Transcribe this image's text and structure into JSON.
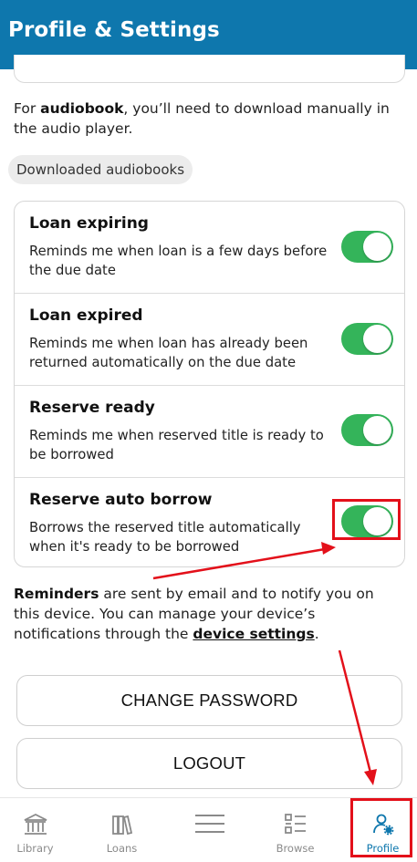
{
  "header": {
    "title": "Profile & Settings"
  },
  "intro": {
    "prefix": "For ",
    "bold": "audiobook",
    "suffix": ", you’ll need to download manually in the audio player."
  },
  "downloaded_pill": "Downloaded audiobooks",
  "notifications": [
    {
      "title": "Loan expiring",
      "description": "Reminds me when loan is a few days before the due date",
      "enabled": true
    },
    {
      "title": "Loan expired",
      "description": "Reminds me when loan has already been returned automatically on the due date",
      "enabled": true
    },
    {
      "title": "Reserve ready",
      "description": "Reminds me when reserved title is ready to be borrowed",
      "enabled": true
    },
    {
      "title": "Reserve auto borrow",
      "description": "Borrows the reserved title automatically when it's ready to be borrowed",
      "enabled": true
    }
  ],
  "reminders": {
    "bold": "Reminders",
    "text": " are sent by email and to notify you on this device.  You can manage your device’s notifications through the ",
    "link": "device settings",
    "end": "."
  },
  "buttons": {
    "change_password": "CHANGE PASSWORD",
    "logout": "LOGOUT"
  },
  "bottom_nav": {
    "items": [
      {
        "label": "Library",
        "icon": "library-icon"
      },
      {
        "label": "Loans",
        "icon": "books-icon"
      },
      {
        "label": "",
        "icon": "menu-icon"
      },
      {
        "label": "Browse",
        "icon": "browse-list-icon"
      },
      {
        "label": "Profile",
        "icon": "profile-gear-icon"
      }
    ],
    "active": "Profile"
  },
  "colors": {
    "header": "#0e77ad",
    "toggle_on": "#34b45a",
    "annotation": "#e3101a",
    "nav_active": "#0e77ad",
    "nav_inactive": "#8a8a8a"
  }
}
